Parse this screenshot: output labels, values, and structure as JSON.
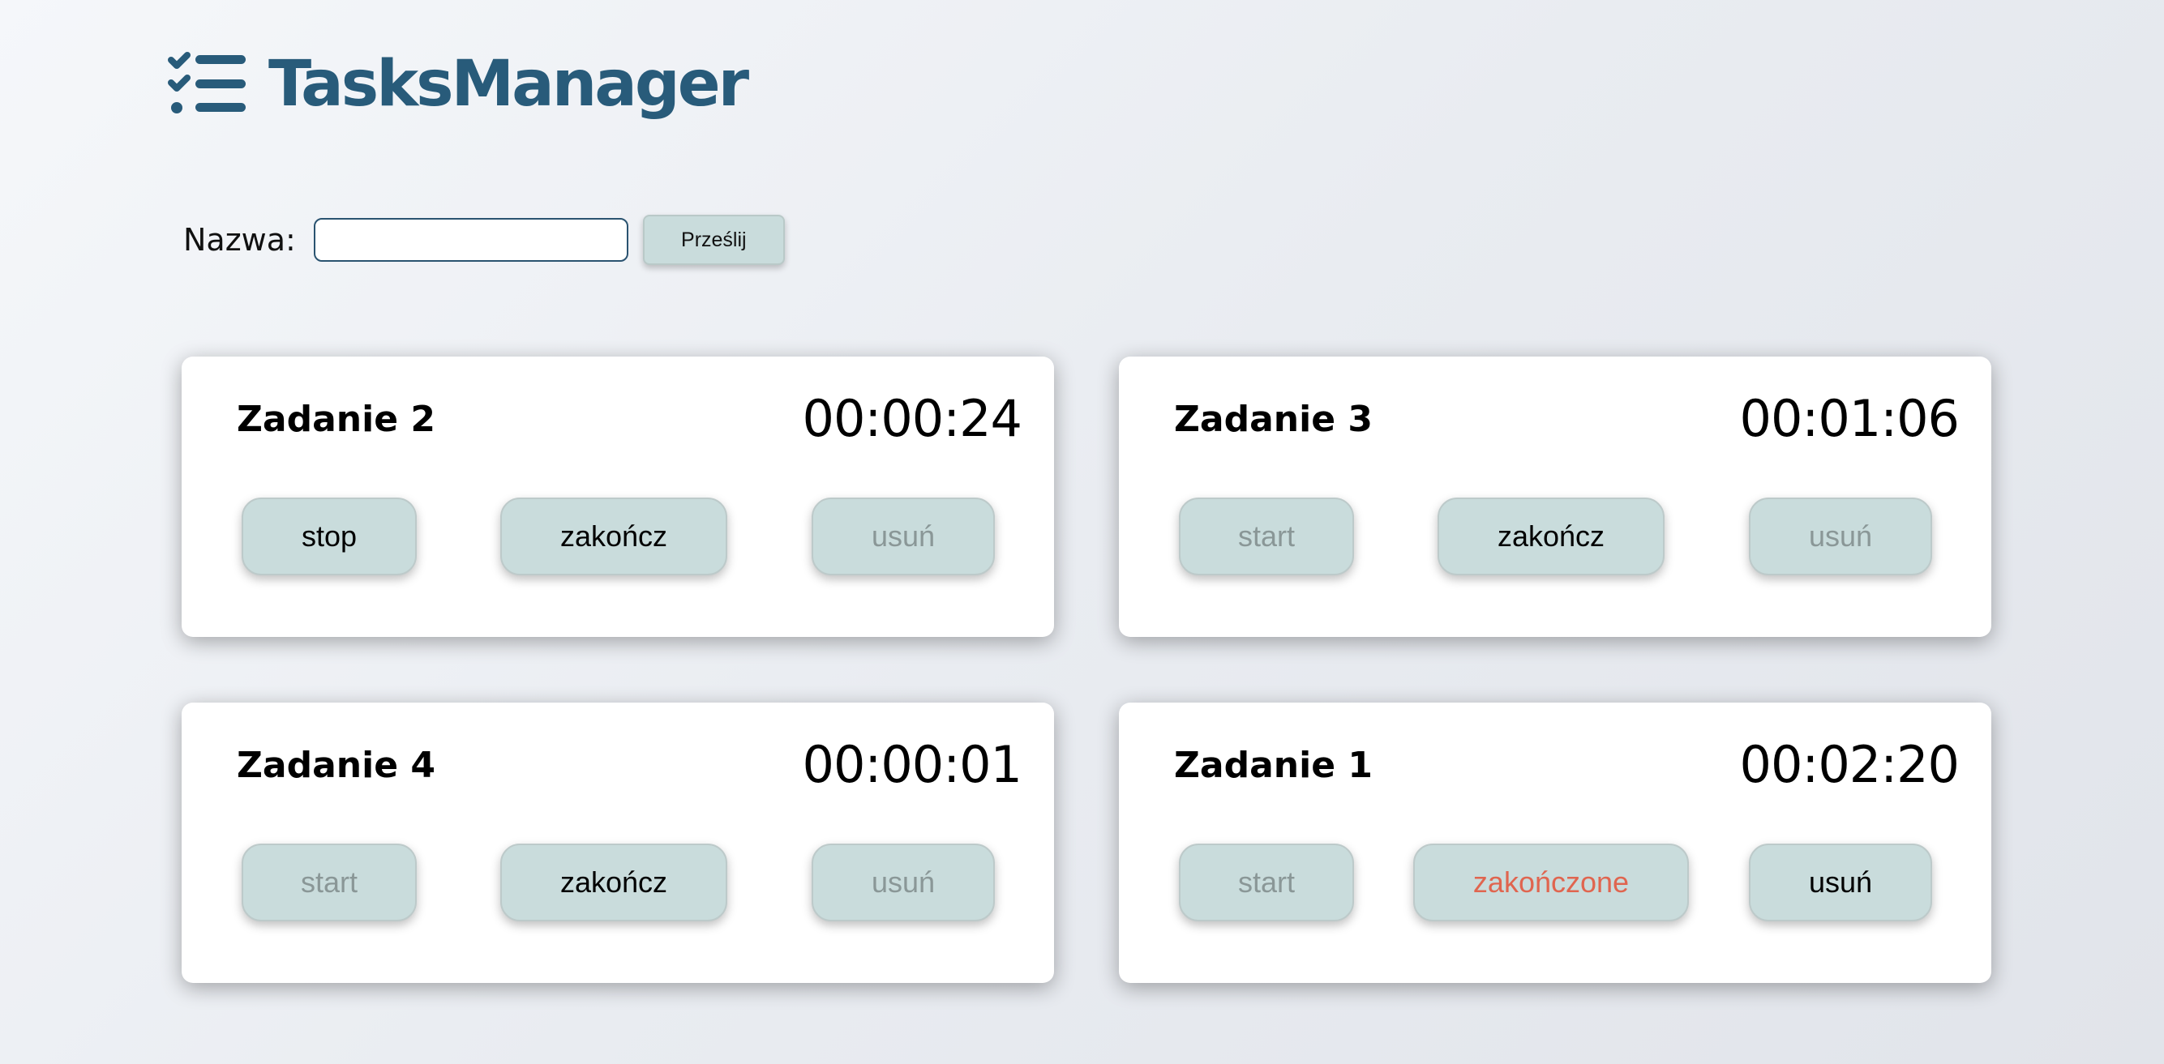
{
  "header": {
    "title": "TasksManager",
    "icon": "checklist-icon",
    "brand_color": "#285b7a"
  },
  "form": {
    "label": "Nazwa:",
    "input_value": "",
    "submit_label": "Prześlij"
  },
  "colors": {
    "button_bg": "#c9dcdc",
    "disabled_text": "#8a9797",
    "done_text": "#e0654f"
  },
  "tasks": [
    {
      "name": "Zadanie 2",
      "time": "00:00:24",
      "buttons": [
        {
          "label": "stop",
          "state": "enabled"
        },
        {
          "label": "zakończ",
          "state": "enabled"
        },
        {
          "label": "usuń",
          "state": "disabled"
        }
      ]
    },
    {
      "name": "Zadanie 3",
      "time": "00:01:06",
      "buttons": [
        {
          "label": "start",
          "state": "disabled"
        },
        {
          "label": "zakończ",
          "state": "enabled"
        },
        {
          "label": "usuń",
          "state": "disabled"
        }
      ]
    },
    {
      "name": "Zadanie 4",
      "time": "00:00:01",
      "buttons": [
        {
          "label": "start",
          "state": "disabled"
        },
        {
          "label": "zakończ",
          "state": "enabled"
        },
        {
          "label": "usuń",
          "state": "disabled"
        }
      ]
    },
    {
      "name": "Zadanie 1",
      "time": "00:02:20",
      "buttons": [
        {
          "label": "start",
          "state": "disabled"
        },
        {
          "label": "zakończone",
          "state": "done"
        },
        {
          "label": "usuń",
          "state": "enabled"
        }
      ]
    }
  ]
}
